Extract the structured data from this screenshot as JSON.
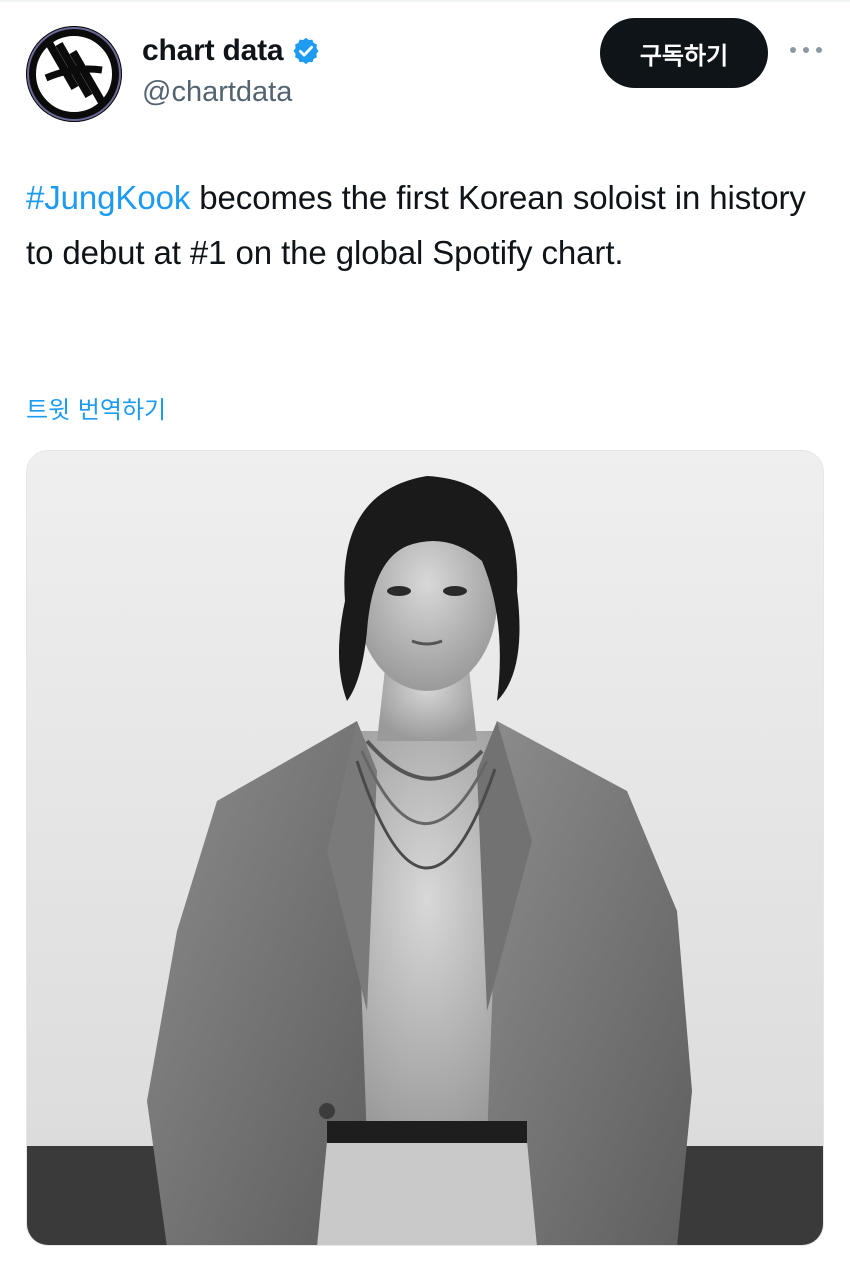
{
  "account": {
    "display_name": "chart data",
    "handle": "@chartdata",
    "verified": true,
    "verified_icon": "verified-badge-icon",
    "avatar_icon": "chart-data-logo"
  },
  "actions": {
    "subscribe_label": "구독하기",
    "more_icon": "more-dots-icon"
  },
  "tweet": {
    "hashtag": "#JungKook",
    "body": " becomes the first Korean soloist in history to debut at #1 on the global Spotify chart.",
    "translate_label": "트윗 번역하기"
  },
  "media": {
    "type": "photo",
    "style": "black-and-white portrait"
  },
  "colors": {
    "accent": "#1d9bf0",
    "text": "#0f1419",
    "secondary_text": "#536471",
    "button_bg": "#0f1419"
  }
}
